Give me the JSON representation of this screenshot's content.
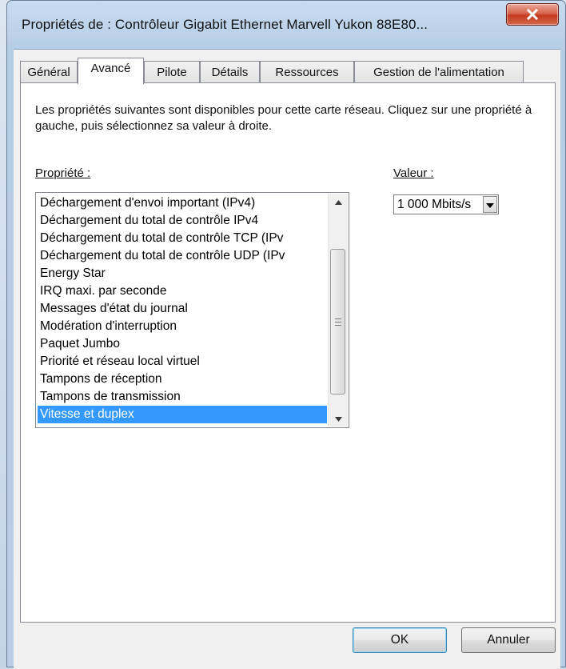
{
  "window": {
    "title": "Propriétés de : Contrôleur Gigabit Ethernet Marvell Yukon 88E80...",
    "close_icon": "close-icon"
  },
  "tabs": [
    {
      "label": "Général",
      "active": false
    },
    {
      "label": "Avancé",
      "active": true
    },
    {
      "label": "Pilote",
      "active": false
    },
    {
      "label": "Détails",
      "active": false
    },
    {
      "label": "Ressources",
      "active": false
    },
    {
      "label": "Gestion de l'alimentation",
      "active": false
    }
  ],
  "panel": {
    "description": "Les propriétés suivantes sont disponibles pour cette carte réseau. Cliquez sur une propriété à gauche, puis sélectionnez sa valeur à droite.",
    "property_label": "Propriété :",
    "value_label": "Valeur :",
    "properties": [
      "Déchargement d'envoi important (IPv4)",
      "Déchargement du total de contrôle IPv4",
      "Déchargement du total de contrôle TCP (IPv",
      "Déchargement du total de contrôle UDP (IPv",
      "Energy Star",
      "IRQ maxi. par seconde",
      "Messages d'état du journal",
      "Modération d'interruption",
      "Paquet Jumbo",
      "Priorité et réseau local virtuel",
      "Tampons de réception",
      "Tampons de transmission",
      "Vitesse et duplex"
    ],
    "selected_property": "Vitesse et duplex",
    "value": "1 000 Mbits/s"
  },
  "buttons": {
    "ok": "OK",
    "cancel": "Annuler"
  },
  "colors": {
    "selection": "#3399ff",
    "close_button": "#c23a1e"
  }
}
